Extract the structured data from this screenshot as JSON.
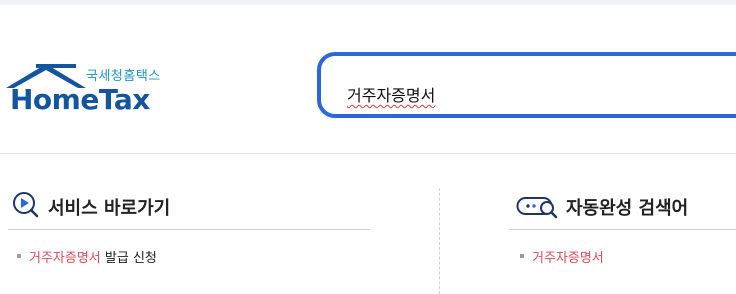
{
  "brand": {
    "name_ko": "국세청홈택스",
    "name_en": "HomeTax",
    "color_primary": "#14559e",
    "color_secondary": "#1f93c9"
  },
  "search": {
    "value": "거주자증명서",
    "border_color": "#2b66dc"
  },
  "sections": {
    "shortcuts": {
      "title": "서비스 바로가기",
      "icon": "play-search-icon",
      "items": [
        {
          "highlight": "거주자증명서",
          "rest": " 발급 신청"
        }
      ]
    },
    "autocomplete": {
      "title": "자동완성 검색어",
      "icon": "chat-search-icon",
      "items": [
        {
          "highlight": "거주자증명서",
          "rest": ""
        }
      ]
    }
  },
  "colors": {
    "highlight": "#e1475a"
  }
}
